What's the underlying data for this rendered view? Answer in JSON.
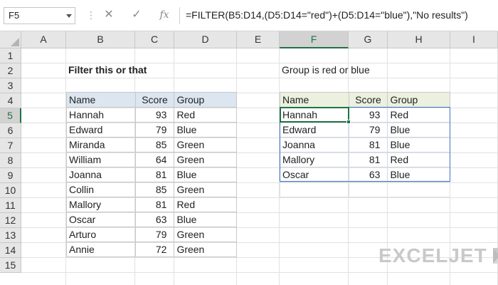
{
  "formula_bar": {
    "name_box": "F5",
    "cancel_symbol": "✕",
    "enter_symbol": "✓",
    "fx_symbol": "fx",
    "formula": "=FILTER(B5:D14,(D5:D14=\"red\")+(D5:D14=\"blue\"),\"No results\")"
  },
  "grid": {
    "columns": [
      "A",
      "B",
      "C",
      "D",
      "E",
      "F",
      "G",
      "H",
      "I"
    ],
    "rows": [
      "1",
      "2",
      "3",
      "4",
      "5",
      "6",
      "7",
      "8",
      "9",
      "10",
      "11",
      "12",
      "13",
      "14",
      "15"
    ],
    "active_column": "F",
    "active_row": "5"
  },
  "sheet": {
    "left_title": "Filter this or that",
    "right_title": "Group is red or blue"
  },
  "source_table": {
    "headers": [
      "Name",
      "Score",
      "Group"
    ],
    "rows": [
      [
        "Hannah",
        "93",
        "Red"
      ],
      [
        "Edward",
        "79",
        "Blue"
      ],
      [
        "Miranda",
        "85",
        "Green"
      ],
      [
        "William",
        "64",
        "Green"
      ],
      [
        "Joanna",
        "81",
        "Blue"
      ],
      [
        "Collin",
        "85",
        "Green"
      ],
      [
        "Mallory",
        "81",
        "Red"
      ],
      [
        "Oscar",
        "63",
        "Blue"
      ],
      [
        "Arturo",
        "79",
        "Green"
      ],
      [
        "Annie",
        "72",
        "Green"
      ]
    ]
  },
  "result_table": {
    "headers": [
      "Name",
      "Score",
      "Group"
    ],
    "rows": [
      [
        "Hannah",
        "93",
        "Red"
      ],
      [
        "Edward",
        "79",
        "Blue"
      ],
      [
        "Joanna",
        "81",
        "Blue"
      ],
      [
        "Mallory",
        "81",
        "Red"
      ],
      [
        "Oscar",
        "63",
        "Blue"
      ]
    ]
  },
  "logo": {
    "text": "EXCELJET"
  },
  "colors": {
    "excel_green": "#217346",
    "spill_border": "#3f74c7",
    "source_header_bg": "#dce6f1",
    "result_header_bg": "#ebf1de"
  }
}
